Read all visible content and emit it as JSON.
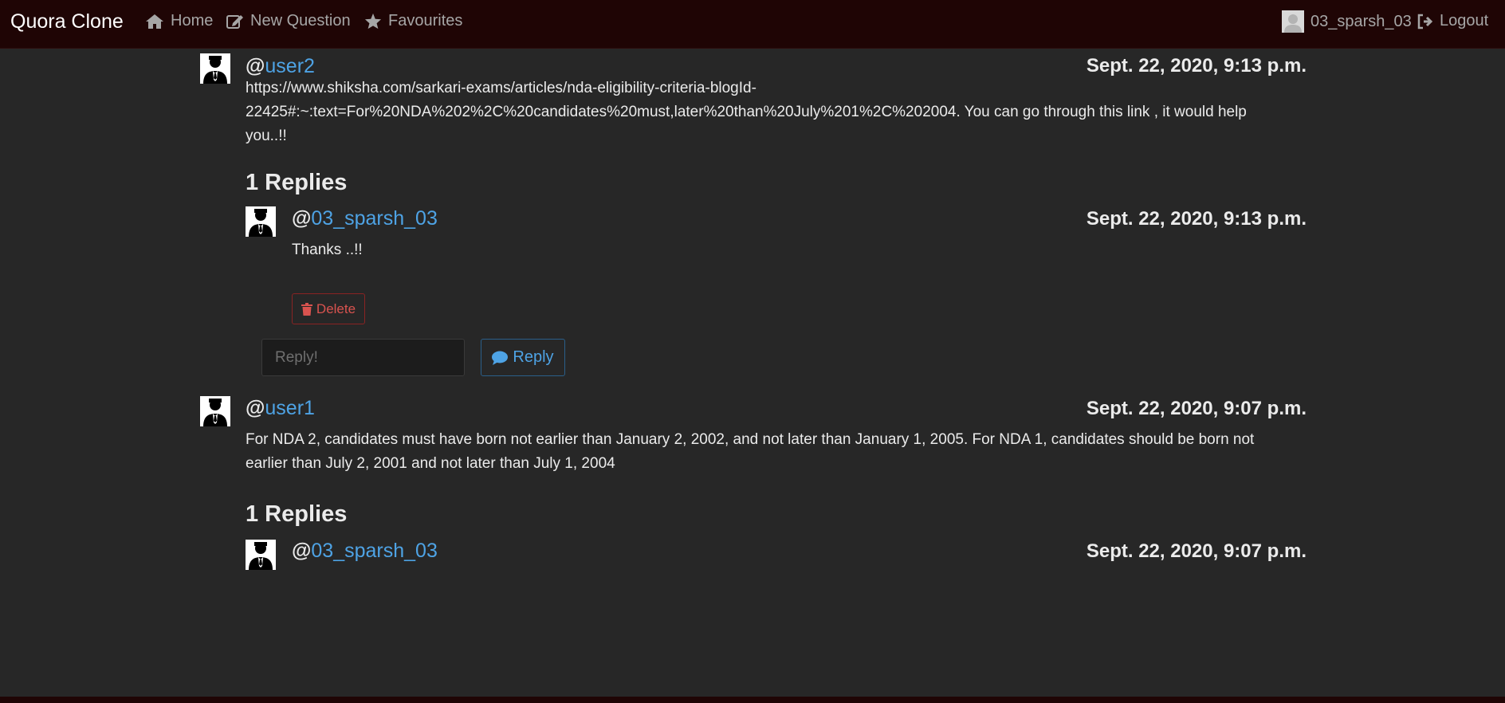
{
  "navbar": {
    "brand": "Quora Clone",
    "home_label": "Home",
    "new_question_label": "New Question",
    "favourites_label": "Favourites",
    "username": "03_sparsh_03",
    "logout_label": "Logout"
  },
  "answers": [
    {
      "at": "@",
      "username": "user2",
      "timestamp": "Sept. 22, 2020, 9:13 p.m.",
      "text_line1": "https://www.shiksha.com/sarkari-exams/articles/nda-eligibility-criteria-blogId-",
      "text_line2": "22425#:~:text=For%20NDA%202%2C%20candidates%20must,later%20than%20July%201%2C%202004. You can go through this link , it would help",
      "text_line3": "you..!!",
      "replies_heading": "1 Replies",
      "reply": {
        "at": "@",
        "username": "03_sparsh_03",
        "timestamp": "Sept. 22, 2020, 9:13 p.m.",
        "text": "Thanks ..!!",
        "delete_label": "Delete"
      },
      "reply_placeholder": "Reply!",
      "reply_button_label": "Reply"
    },
    {
      "at": "@",
      "username": "user1",
      "timestamp": "Sept. 22, 2020, 9:07 p.m.",
      "text_line1": "For NDA 2, candidates must have born not earlier than January 2, 2002, and not later than January 1, 2005. For NDA 1, candidates should be born not",
      "text_line2": "earlier than July 2, 2001 and not later than July 1, 2004",
      "replies_heading": "1 Replies",
      "reply": {
        "at": "@",
        "username": "03_sparsh_03",
        "timestamp": "Sept. 22, 2020, 9:07 p.m."
      }
    }
  ],
  "colors": {
    "navbar_bg": "#1f0505",
    "page_bg": "#272727",
    "link": "#4ea3e5",
    "danger": "#d9534f"
  }
}
